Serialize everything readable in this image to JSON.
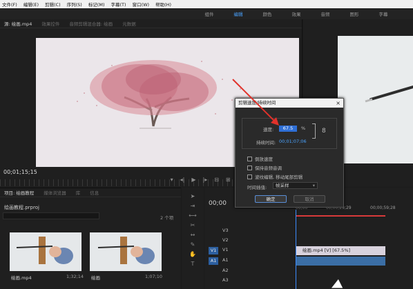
{
  "menu": [
    "文件(F)",
    "编辑(E)",
    "剪辑(C)",
    "序列(S)",
    "标记(M)",
    "字幕(T)",
    "窗口(W)",
    "帮助(H)"
  ],
  "workspaces": [
    {
      "label": "组件",
      "active": false
    },
    {
      "label": "编辑",
      "active": true
    },
    {
      "label": "颜色",
      "active": false
    },
    {
      "label": "效果",
      "active": false
    },
    {
      "label": "音频",
      "active": false
    },
    {
      "label": "图形",
      "active": false
    },
    {
      "label": "字幕",
      "active": false
    }
  ],
  "source_panel": {
    "tabs": [
      "源: 绘画.mp4",
      "效果控件",
      "音频剪辑混合器: 绘画",
      "元数据"
    ],
    "timecode": "00;01;15;15"
  },
  "project_panel": {
    "tabs": [
      "项目: 绘画教程",
      "媒体浏览器",
      "库",
      "信息"
    ],
    "project_name": "绘画教程.prproj",
    "item_count": "2 个项",
    "clips": [
      {
        "name": "绘画.mp4",
        "duration": "1;32;14"
      },
      {
        "name": "绘画",
        "duration": "1;07;10"
      }
    ]
  },
  "timeline": {
    "timecode": "00;00",
    "ruler_labels": [
      "00;00",
      "00;00;29;29",
      "00;00;59;28"
    ],
    "tracks": [
      {
        "name": "V3",
        "patch": ""
      },
      {
        "name": "V2",
        "patch": ""
      },
      {
        "name": "V1",
        "patch": "V1"
      },
      {
        "name": "A1",
        "patch": "A1"
      },
      {
        "name": "A2",
        "patch": ""
      },
      {
        "name": "A3",
        "patch": ""
      }
    ],
    "video_clip_label": "绘画.mp4 [V] [67.5%]"
  },
  "dialog": {
    "title": "剪辑速度/持续时间",
    "speed_label": "速度:",
    "speed_value": "67.5",
    "speed_unit": "%",
    "duration_label": "持续时间:",
    "duration_value": "00;01;07;06",
    "options": [
      "倒放速度",
      "保持音频音调",
      "波纹编辑, 移动尾部剪辑"
    ],
    "interp_label": "时间插值:",
    "interp_value": "帧采样",
    "ok_label": "确定",
    "cancel_label": "取消"
  },
  "colors": {
    "accent": "#4aa3ff",
    "selection": "#2f6fd6",
    "work_area": "#d83a3a",
    "annotation_arrow": "#e0322b"
  }
}
